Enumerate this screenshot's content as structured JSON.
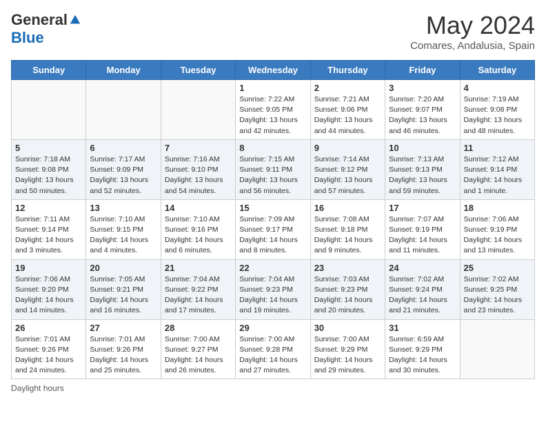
{
  "header": {
    "logo_general": "General",
    "logo_blue": "Blue",
    "month_year": "May 2024",
    "location": "Comares, Andalusia, Spain"
  },
  "days_of_week": [
    "Sunday",
    "Monday",
    "Tuesday",
    "Wednesday",
    "Thursday",
    "Friday",
    "Saturday"
  ],
  "weeks": [
    [
      {
        "num": "",
        "info": ""
      },
      {
        "num": "",
        "info": ""
      },
      {
        "num": "",
        "info": ""
      },
      {
        "num": "1",
        "info": "Sunrise: 7:22 AM\nSunset: 9:05 PM\nDaylight: 13 hours\nand 42 minutes."
      },
      {
        "num": "2",
        "info": "Sunrise: 7:21 AM\nSunset: 9:06 PM\nDaylight: 13 hours\nand 44 minutes."
      },
      {
        "num": "3",
        "info": "Sunrise: 7:20 AM\nSunset: 9:07 PM\nDaylight: 13 hours\nand 46 minutes."
      },
      {
        "num": "4",
        "info": "Sunrise: 7:19 AM\nSunset: 9:08 PM\nDaylight: 13 hours\nand 48 minutes."
      }
    ],
    [
      {
        "num": "5",
        "info": "Sunrise: 7:18 AM\nSunset: 9:08 PM\nDaylight: 13 hours\nand 50 minutes."
      },
      {
        "num": "6",
        "info": "Sunrise: 7:17 AM\nSunset: 9:09 PM\nDaylight: 13 hours\nand 52 minutes."
      },
      {
        "num": "7",
        "info": "Sunrise: 7:16 AM\nSunset: 9:10 PM\nDaylight: 13 hours\nand 54 minutes."
      },
      {
        "num": "8",
        "info": "Sunrise: 7:15 AM\nSunset: 9:11 PM\nDaylight: 13 hours\nand 56 minutes."
      },
      {
        "num": "9",
        "info": "Sunrise: 7:14 AM\nSunset: 9:12 PM\nDaylight: 13 hours\nand 57 minutes."
      },
      {
        "num": "10",
        "info": "Sunrise: 7:13 AM\nSunset: 9:13 PM\nDaylight: 13 hours\nand 59 minutes."
      },
      {
        "num": "11",
        "info": "Sunrise: 7:12 AM\nSunset: 9:14 PM\nDaylight: 14 hours\nand 1 minute."
      }
    ],
    [
      {
        "num": "12",
        "info": "Sunrise: 7:11 AM\nSunset: 9:14 PM\nDaylight: 14 hours\nand 3 minutes."
      },
      {
        "num": "13",
        "info": "Sunrise: 7:10 AM\nSunset: 9:15 PM\nDaylight: 14 hours\nand 4 minutes."
      },
      {
        "num": "14",
        "info": "Sunrise: 7:10 AM\nSunset: 9:16 PM\nDaylight: 14 hours\nand 6 minutes."
      },
      {
        "num": "15",
        "info": "Sunrise: 7:09 AM\nSunset: 9:17 PM\nDaylight: 14 hours\nand 8 minutes."
      },
      {
        "num": "16",
        "info": "Sunrise: 7:08 AM\nSunset: 9:18 PM\nDaylight: 14 hours\nand 9 minutes."
      },
      {
        "num": "17",
        "info": "Sunrise: 7:07 AM\nSunset: 9:19 PM\nDaylight: 14 hours\nand 11 minutes."
      },
      {
        "num": "18",
        "info": "Sunrise: 7:06 AM\nSunset: 9:19 PM\nDaylight: 14 hours\nand 13 minutes."
      }
    ],
    [
      {
        "num": "19",
        "info": "Sunrise: 7:06 AM\nSunset: 9:20 PM\nDaylight: 14 hours\nand 14 minutes."
      },
      {
        "num": "20",
        "info": "Sunrise: 7:05 AM\nSunset: 9:21 PM\nDaylight: 14 hours\nand 16 minutes."
      },
      {
        "num": "21",
        "info": "Sunrise: 7:04 AM\nSunset: 9:22 PM\nDaylight: 14 hours\nand 17 minutes."
      },
      {
        "num": "22",
        "info": "Sunrise: 7:04 AM\nSunset: 9:23 PM\nDaylight: 14 hours\nand 19 minutes."
      },
      {
        "num": "23",
        "info": "Sunrise: 7:03 AM\nSunset: 9:23 PM\nDaylight: 14 hours\nand 20 minutes."
      },
      {
        "num": "24",
        "info": "Sunrise: 7:02 AM\nSunset: 9:24 PM\nDaylight: 14 hours\nand 21 minutes."
      },
      {
        "num": "25",
        "info": "Sunrise: 7:02 AM\nSunset: 9:25 PM\nDaylight: 14 hours\nand 23 minutes."
      }
    ],
    [
      {
        "num": "26",
        "info": "Sunrise: 7:01 AM\nSunset: 9:26 PM\nDaylight: 14 hours\nand 24 minutes."
      },
      {
        "num": "27",
        "info": "Sunrise: 7:01 AM\nSunset: 9:26 PM\nDaylight: 14 hours\nand 25 minutes."
      },
      {
        "num": "28",
        "info": "Sunrise: 7:00 AM\nSunset: 9:27 PM\nDaylight: 14 hours\nand 26 minutes."
      },
      {
        "num": "29",
        "info": "Sunrise: 7:00 AM\nSunset: 9:28 PM\nDaylight: 14 hours\nand 27 minutes."
      },
      {
        "num": "30",
        "info": "Sunrise: 7:00 AM\nSunset: 9:29 PM\nDaylight: 14 hours\nand 29 minutes."
      },
      {
        "num": "31",
        "info": "Sunrise: 6:59 AM\nSunset: 9:29 PM\nDaylight: 14 hours\nand 30 minutes."
      },
      {
        "num": "",
        "info": ""
      }
    ]
  ],
  "footer": {
    "daylight_label": "Daylight hours"
  }
}
